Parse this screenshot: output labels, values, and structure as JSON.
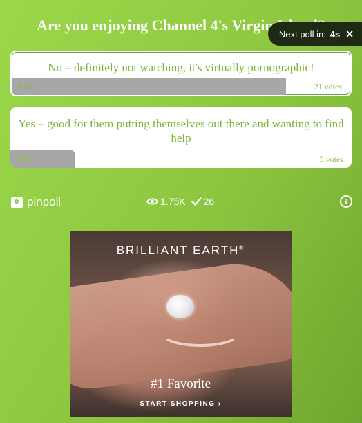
{
  "poll": {
    "title": "Are you enjoying Channel 4's Virgin Island?",
    "next_poll_label": "Next poll in:",
    "next_poll_seconds": "4s",
    "close_glyph": "✕",
    "answers": [
      {
        "text": "No – definitely not watching, it's virtually pornographic!",
        "percent": "81%",
        "votes": "21 votes",
        "fraction": 0.81
      },
      {
        "text": "Yes – good for them putting themselves out there and wanting to find help",
        "percent": "19%",
        "votes": "5 votes",
        "fraction": 0.19
      }
    ]
  },
  "footer": {
    "brand": "pinpoll",
    "views": "1.75K",
    "checks": "26",
    "info_glyph": "i"
  },
  "ad": {
    "brand_name": "BRILLIANT EARTH",
    "brand_mark": "®",
    "headline": "#1 Favorite",
    "cta": "START SHOPPING ›"
  },
  "colors": {
    "background": "#8cc63f",
    "answer_text": "#7ab536",
    "result_bar": "#a7a7a7",
    "timer_bg": "#1e2a14"
  },
  "icons": [
    "eye-icon",
    "check-icon",
    "info-icon",
    "close-icon",
    "pinpoll-logo-icon"
  ]
}
